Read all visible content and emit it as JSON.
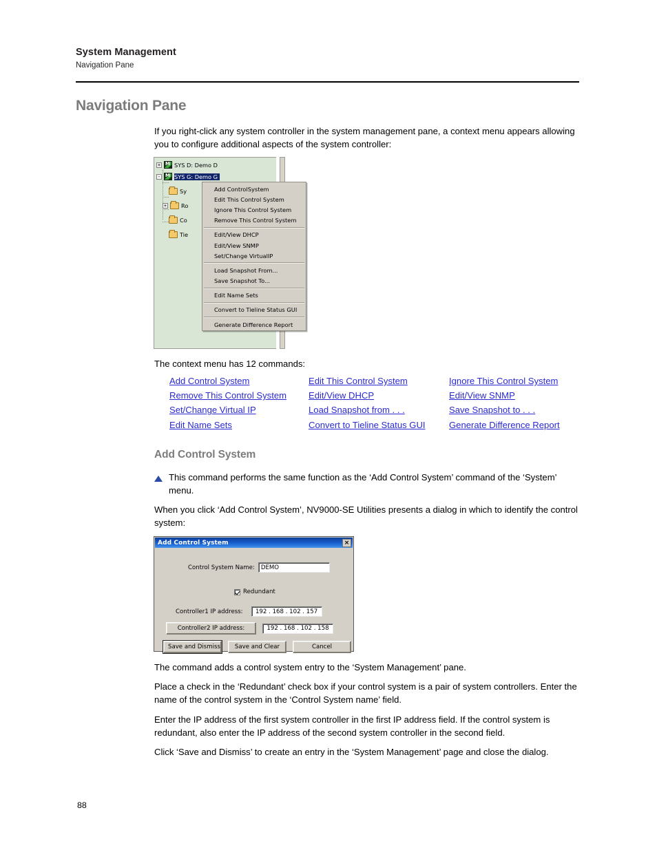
{
  "header": {
    "title": "System Management",
    "subtitle": "Navigation Pane"
  },
  "section_heading": "Navigation Pane",
  "intro_paragraph": "If you right-click any system controller in the system management pane, a context menu appears allowing you to configure additional aspects of the system controller:",
  "tree_screenshot": {
    "rows": [
      {
        "toggle": "+",
        "icon": "nv-logo-icon",
        "label": "SYS D: Demo D",
        "selected": false
      },
      {
        "toggle": "-",
        "icon": "nv-logo-icon",
        "label": "SYS G: Demo G",
        "selected": true
      },
      {
        "toggle": "",
        "icon": "folder-icon",
        "label": "Sy",
        "selected": false
      },
      {
        "toggle": "+",
        "icon": "folder-icon",
        "label": "Ro",
        "selected": false
      },
      {
        "toggle": "",
        "icon": "folder-icon",
        "label": "Co",
        "selected": false
      },
      {
        "toggle": "",
        "icon": "folder-icon",
        "label": "Tie",
        "selected": false
      }
    ],
    "pane_background": "#d9e6d6",
    "selection_color": "#12256b"
  },
  "context_menu": {
    "background": "#d4d0c8",
    "groups": [
      [
        "Add ControlSystem",
        "Edit This Control System",
        "Ignore This Control System",
        "Remove This Control System"
      ],
      [
        "Edit/View DHCP",
        "Edit/View SNMP",
        "Set/Change VirtualIP"
      ],
      [
        "Load Snapshot From...",
        "Save Snapshot To..."
      ],
      [
        "Edit Name Sets"
      ],
      [
        "Convert to Tieline Status GUI"
      ],
      [
        "Generate Difference Report"
      ]
    ]
  },
  "commands_intro": "The context menu has 12 commands:",
  "commands": [
    "Add Control System",
    "Edit This Control System",
    "Ignore This Control System",
    "Remove This Control System",
    "Edit/View DHCP",
    "Edit/View SNMP",
    "Set/Change Virtual IP",
    "Load Snapshot from . . .",
    "Save Snapshot to . . .",
    "Edit Name Sets",
    "Convert to Tieline Status GUI",
    "Generate Difference Report"
  ],
  "commands_link_color": "#2a2ad0",
  "add_control_system": {
    "heading": "Add Control System",
    "note": "This command performs the same function as the ‘Add Control System’ command of the ‘System’ menu.",
    "note_marker_color": "#2b4aa8",
    "paragraph": "When you click ‘Add Control System’, NV9000-SE Utilities presents a dialog in which to identify the control system:"
  },
  "dialog": {
    "title": "Add Control System",
    "close_label": "×",
    "titlebar_color": "#1559c4",
    "name_label": "Control System Name:",
    "name_value": "DEMO",
    "redundant_label": "Redundant",
    "redundant_checked": true,
    "controller1_label": "Controller1 IP address:",
    "controller1_value": "192 . 168 . 102 . 157",
    "controller2_label": "Controller2 IP address:",
    "controller2_value": "192 . 168 . 102 . 158",
    "buttons": [
      "Save and Dismiss",
      "Save and Clear",
      "Cancel"
    ]
  },
  "closing_paragraphs": [
    "The command adds a control system entry to the ‘System Management’ pane.",
    "Place a check in the ‘Redundant’ check box if your control system is a pair of system controllers. Enter the name of the control system in the ‘Control System name’ field.",
    "Enter the IP address of the first system controller in the first IP address field. If the control system is redundant, also enter the IP address of the second system controller in the second field.",
    "Click ‘Save and Dismiss’ to create an entry in the ‘System Management’ page and close the dialog."
  ],
  "page_number": "88"
}
